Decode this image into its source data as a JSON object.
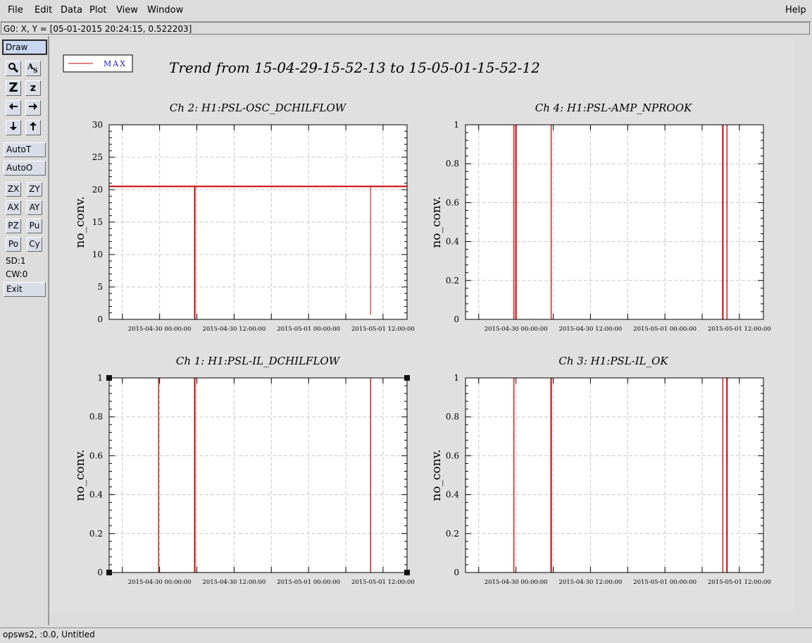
{
  "menu": {
    "items": [
      "File",
      "Edit",
      "Data",
      "Plot",
      "View",
      "Window"
    ],
    "help": "Help"
  },
  "coord_readout": "G0: X, Y = [05-01-2015 20:24:15, 0.522203]",
  "toolbar": {
    "draw": "Draw",
    "zoom_z_big": "Z",
    "zoom_z_small": "z",
    "auto_t": "AutoT",
    "auto_o": "AutoO",
    "zx": "ZX",
    "zy": "ZY",
    "ax": "AX",
    "ay": "AY",
    "pz": "PZ",
    "pu": "Pu",
    "po": "Po",
    "cy": "Cy",
    "sd": "SD:1",
    "cw": "CW:0",
    "exit": "Exit"
  },
  "legend": {
    "label": "MAX",
    "line_color": "#cc0000"
  },
  "page_title": "Trend from 15-04-29-15-52-13 to 15-05-01-15-52-12",
  "status": "opsws2, :0.0, Untitled",
  "chart_data": [
    {
      "type": "line",
      "title": "Ch 2: H1:PSL-OSC_DCHILFLOW",
      "ylabel": "no_conv.",
      "ylim": [
        0,
        30
      ],
      "yticks": [
        "0",
        "5",
        "10",
        "15",
        "20",
        "25",
        "30"
      ],
      "xlim": [
        "2015-04-29 15:52:13",
        "2015-05-01 15:52:12"
      ],
      "xticks": [
        "2015-04-30 00:00:00",
        "2015-04-30 12:00:00",
        "2015-05-01 00:00:00",
        "2015-05-01 12:00:00"
      ],
      "series": [
        {
          "name": "MAX",
          "color": "#cc0000",
          "level": 20.5,
          "dropouts": [
            {
              "time": "2015-04-30 05:40:00",
              "value": 0
            },
            {
              "time": "2015-05-01 10:00:00",
              "value": 0.7
            }
          ]
        }
      ]
    },
    {
      "type": "line",
      "title": "Ch 4: H1:PSL-AMP_NPROOK",
      "ylabel": "no_conv.",
      "ylim": [
        0,
        1
      ],
      "yticks": [
        "0",
        "0.2",
        "0.4",
        "0.6",
        "0.8",
        "1"
      ],
      "xlim": [
        "2015-04-29 15:52:13",
        "2015-05-01 15:52:12"
      ],
      "xticks": [
        "2015-04-30 00:00:00",
        "2015-04-30 12:00:00",
        "2015-05-01 00:00:00",
        "2015-05-01 12:00:00"
      ],
      "series": [
        {
          "name": "MAX",
          "color": "#cc0000",
          "spikes": [
            "2015-04-29 23:40:00",
            "2015-04-30 00:00:00",
            "2015-04-30 05:40:00",
            "2015-05-01 09:20:00",
            "2015-05-01 10:00:00"
          ]
        }
      ]
    },
    {
      "type": "line",
      "title": "Ch 1: H1:PSL-IL_DCHILFLOW",
      "ylabel": "no_conv.",
      "ylim": [
        0,
        1
      ],
      "yticks": [
        "0",
        "0.2",
        "0.4",
        "0.6",
        "0.8",
        "1"
      ],
      "xlim": [
        "2015-04-29 15:52:13",
        "2015-05-01 15:52:12"
      ],
      "xticks": [
        "2015-04-30 00:00:00",
        "2015-04-30 12:00:00",
        "2015-05-01 00:00:00",
        "2015-05-01 12:00:00"
      ],
      "series": [
        {
          "name": "MAX",
          "color": "#cc0000",
          "spikes": [
            "2015-04-29 23:50:00",
            "2015-04-30 05:40:00",
            "2015-05-01 10:00:00"
          ]
        }
      ]
    },
    {
      "type": "line",
      "title": "Ch 3: H1:PSL-IL_OK",
      "ylabel": "no_conv.",
      "ylim": [
        0,
        1
      ],
      "yticks": [
        "0",
        "0.2",
        "0.4",
        "0.6",
        "0.8",
        "1"
      ],
      "xlim": [
        "2015-04-29 15:52:13",
        "2015-05-01 15:52:12"
      ],
      "xticks": [
        "2015-04-30 00:00:00",
        "2015-04-30 12:00:00",
        "2015-05-01 00:00:00",
        "2015-05-01 12:00:00"
      ],
      "series": [
        {
          "name": "MAX",
          "color": "#cc0000",
          "spikes": [
            "2015-04-29 23:40:00",
            "2015-04-30 05:40:00",
            "2015-05-01 09:20:00",
            "2015-05-01 10:00:00"
          ]
        }
      ]
    }
  ]
}
